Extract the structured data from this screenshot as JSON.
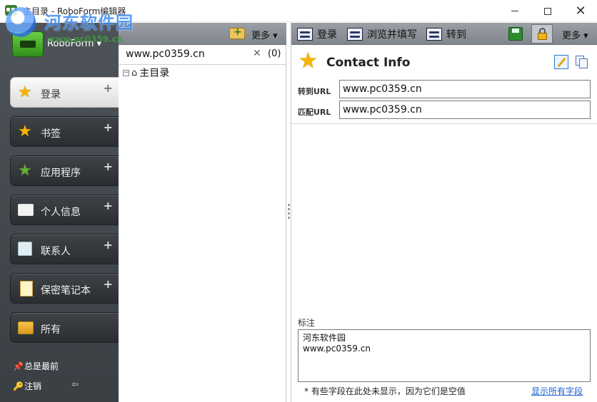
{
  "window": {
    "title": "主目录 - RoboForm编辑器",
    "minimize": "minimize",
    "maximize": "maximize",
    "close": "✕"
  },
  "watermark": {
    "title": "河东软件园",
    "url": "www.pc0359.cn"
  },
  "sidebar": {
    "brand": "RoboForm ▾",
    "items": [
      {
        "label": "登录",
        "icon": "passcard-star-icon",
        "plus": "+",
        "selected": true
      },
      {
        "label": "书签",
        "icon": "bookmark-star-icon",
        "plus": "+",
        "selected": false
      },
      {
        "label": "应用程序",
        "icon": "application-star-icon",
        "plus": "+",
        "selected": false
      },
      {
        "label": "个人信息",
        "icon": "identity-card-icon",
        "plus": "+",
        "selected": false
      },
      {
        "label": "联系人",
        "icon": "contact-card-icon",
        "plus": "+",
        "selected": false
      },
      {
        "label": "保密笔记本",
        "icon": "safenote-icon",
        "plus": "+",
        "selected": false
      },
      {
        "label": "所有",
        "icon": "all-items-icon",
        "plus": "+",
        "selected": false
      }
    ],
    "always_on_top": "总是最前",
    "logoff": "注销",
    "back": "⇦"
  },
  "middle": {
    "more": "更多 ▾",
    "tab_name": "www.pc0359.cn",
    "tab_close": "✕",
    "tab_count": "(0)",
    "tree_expand": "−",
    "tree_root": "主目录"
  },
  "right": {
    "toolbar": {
      "login": "登录",
      "browse_fill": "浏览并填写",
      "goto": "转到",
      "more": "更多 ▾"
    },
    "header_title": "Contact Info",
    "fields": [
      {
        "label": "转到URL",
        "value": "www.pc0359.cn"
      },
      {
        "label": "匹配URL",
        "value": "www.pc0359.cn"
      }
    ],
    "note_label": "标注",
    "note_value": "河东软件园\nwww.pc0359.cn",
    "footer_text": "* 有些字段在此处未显示，因为它们是空值",
    "show_all": "显示所有字段"
  },
  "colors": {
    "sidebar_bg": "#43494e",
    "toolbar_bg": "#8c9298",
    "accent_star": "#f7b500",
    "link": "#1a5fcf"
  }
}
